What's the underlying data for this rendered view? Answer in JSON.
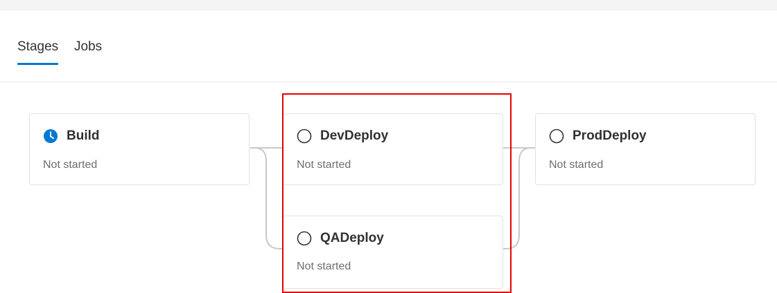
{
  "tabs": [
    {
      "label": "Stages",
      "selected": true
    },
    {
      "label": "Jobs",
      "selected": false
    }
  ],
  "colors": {
    "accent": "#0078d4",
    "highlight": "#e30000",
    "connector": "#c8c8c8"
  },
  "stages": [
    {
      "name": "Build",
      "status": "Not started",
      "icon": "clock-icon"
    },
    {
      "name": "DevDeploy",
      "status": "Not started",
      "icon": "empty-circle-icon"
    },
    {
      "name": "QADeploy",
      "status": "Not started",
      "icon": "empty-circle-icon"
    },
    {
      "name": "ProdDeploy",
      "status": "Not started",
      "icon": "empty-circle-icon"
    }
  ]
}
